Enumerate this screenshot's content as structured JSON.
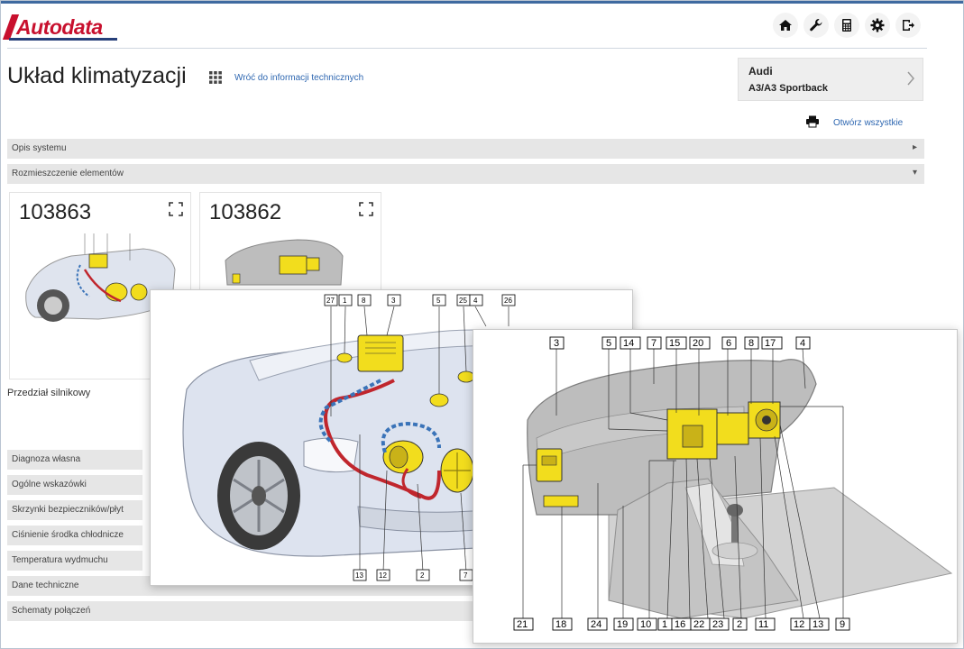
{
  "app": {
    "logo_text": "Autodata"
  },
  "header": {
    "icons": [
      "home-icon",
      "wrench-icon",
      "calculator-icon",
      "gear-icon",
      "logout-icon"
    ]
  },
  "page": {
    "title": "Układ klimatyzacji",
    "back_link": "Wróć do informacji technicznych"
  },
  "vehicle": {
    "make": "Audi",
    "model": "A3/A3 Sportback"
  },
  "actions": {
    "open_all": "Otwórz wszystkie"
  },
  "sections": [
    {
      "label": "Opis systemu",
      "expanded": false
    },
    {
      "label": "Rozmieszczenie elementów",
      "expanded": true
    }
  ],
  "thumbnails": [
    {
      "number": "103863"
    },
    {
      "number": "103862"
    }
  ],
  "caption": "Przedział silnikowy",
  "side_menu": [
    "Diagnoza własna",
    "Ogólne wskazówki",
    "Skrzynki bezpieczników/płyt",
    "Ciśnienie środka chłodnicze",
    "Temperatura wydmuchu",
    "Dane techniczne",
    "Schematy połączeń"
  ],
  "diagram_engine": {
    "top_labels": [
      "27",
      "1",
      "8",
      "3",
      "5",
      "25",
      "4",
      "26"
    ],
    "bottom_labels": [
      "13",
      "12",
      "2",
      "7"
    ]
  },
  "diagram_dash": {
    "top_labels": [
      "3",
      "5",
      "14",
      "7",
      "15",
      "20",
      "6",
      "8",
      "17",
      "4"
    ],
    "bottom_labels": [
      "21",
      "18",
      "24",
      "19",
      "10",
      "1",
      "16",
      "22",
      "23",
      "2",
      "11",
      "12",
      "13",
      "9"
    ]
  },
  "colors": {
    "brand_red": "#c8102e",
    "link_blue": "#2e67b1",
    "component_yellow": "#f2dd1d",
    "pipe_red": "#c0262d",
    "pipe_blue": "#3a73b8"
  }
}
